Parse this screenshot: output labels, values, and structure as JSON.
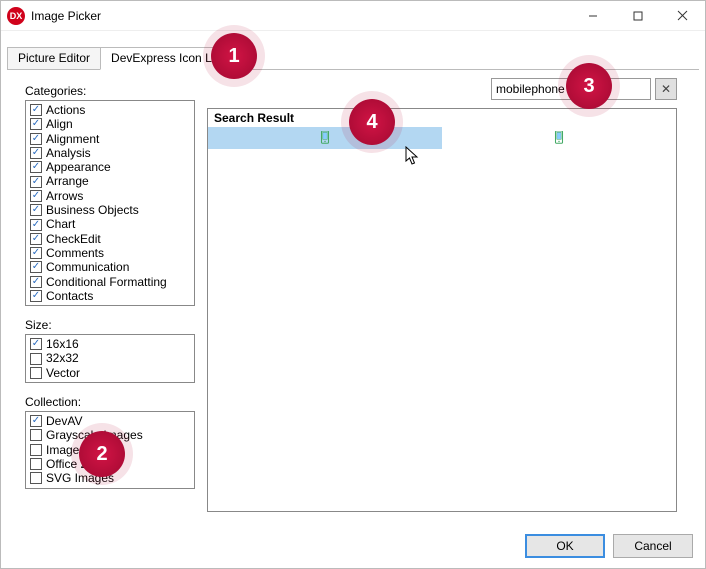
{
  "window": {
    "title": "Image Picker",
    "app_badge": "DX"
  },
  "tabs": {
    "picture_editor": "Picture Editor",
    "icon_library": "DevExpress Icon Library"
  },
  "labels": {
    "categories": "Categories:",
    "size": "Size:",
    "collection": "Collection:",
    "search_result": "Search Result"
  },
  "categories": [
    {
      "label": "Actions",
      "checked": true
    },
    {
      "label": "Align",
      "checked": true
    },
    {
      "label": "Alignment",
      "checked": true
    },
    {
      "label": "Analysis",
      "checked": true
    },
    {
      "label": "Appearance",
      "checked": true
    },
    {
      "label": "Arrange",
      "checked": true
    },
    {
      "label": "Arrows",
      "checked": true
    },
    {
      "label": "Business Objects",
      "checked": true
    },
    {
      "label": "Chart",
      "checked": true
    },
    {
      "label": "CheckEdit",
      "checked": true
    },
    {
      "label": "Comments",
      "checked": true
    },
    {
      "label": "Communication",
      "checked": true
    },
    {
      "label": "Conditional Formatting",
      "checked": true
    },
    {
      "label": "Contacts",
      "checked": true
    }
  ],
  "sizes": [
    {
      "label": "16x16",
      "checked": true
    },
    {
      "label": "32x32",
      "checked": false
    },
    {
      "label": "Vector",
      "checked": false
    }
  ],
  "collections": [
    {
      "label": "DevAV",
      "checked": true
    },
    {
      "label": "Grayscale Images",
      "checked": false
    },
    {
      "label": "Images",
      "checked": false
    },
    {
      "label": "Office 2013",
      "checked": false
    },
    {
      "label": "SVG Images",
      "checked": false
    }
  ],
  "search": {
    "value": "mobilephone",
    "clear_glyph": "✕"
  },
  "results": [
    {
      "icon": "mobilephone",
      "selected": true
    },
    {
      "icon": "mobilephone",
      "selected": false
    }
  ],
  "buttons": {
    "ok": "OK",
    "cancel": "Cancel"
  },
  "callouts": {
    "c1": "1",
    "c2": "2",
    "c3": "3",
    "c4": "4"
  }
}
